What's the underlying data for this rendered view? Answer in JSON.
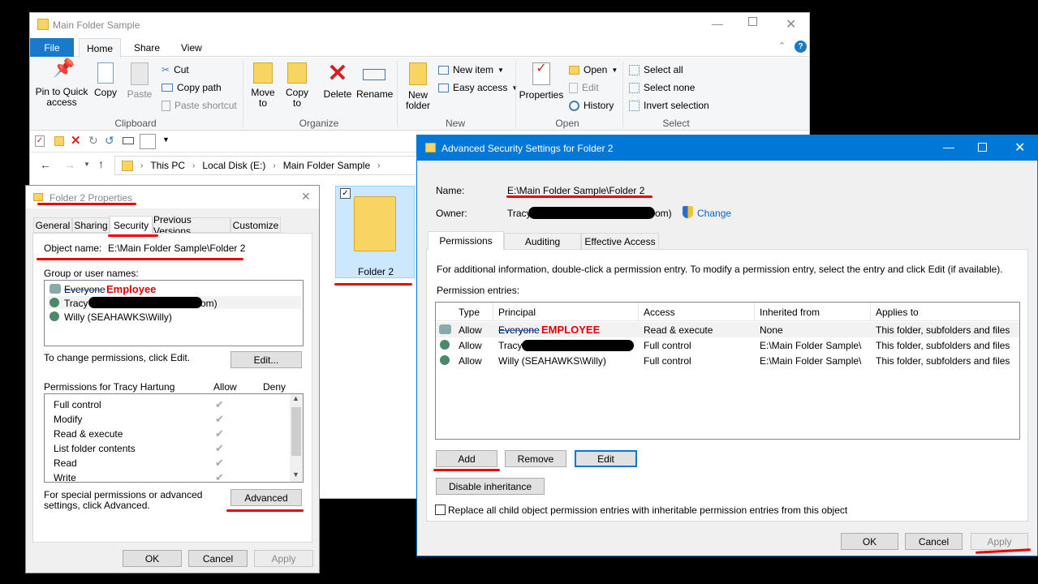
{
  "explorer": {
    "title": "Main Folder Sample",
    "tabs": [
      "File",
      "Home",
      "Share",
      "View"
    ],
    "clipboard": {
      "pin": "Pin to Quick access",
      "copy": "Copy",
      "paste": "Paste",
      "cut": "Cut",
      "copy_path": "Copy path",
      "paste_shortcut": "Paste shortcut",
      "label": "Clipboard"
    },
    "organize": {
      "move_to": "Move to",
      "copy_to": "Copy to",
      "delete": "Delete",
      "rename": "Rename",
      "label": "Organize"
    },
    "new": {
      "new_folder": "New folder",
      "new_item": "New item",
      "easy_access": "Easy access",
      "label": "New"
    },
    "open": {
      "properties": "Properties",
      "open": "Open",
      "edit": "Edit",
      "history": "History",
      "label": "Open"
    },
    "select": {
      "select_all": "Select all",
      "select_none": "Select none",
      "invert": "Invert selection",
      "label": "Select"
    },
    "breadcrumb": [
      "This PC",
      "Local Disk (E:)",
      "Main Folder Sample"
    ],
    "folder_item": "Folder 2"
  },
  "props": {
    "title": "Folder 2 Properties",
    "tabs": [
      "General",
      "Sharing",
      "Security",
      "Previous Versions",
      "Customize"
    ],
    "object_name_label": "Object name:",
    "object_name": "E:\\Main Folder Sample\\Folder 2",
    "group_label": "Group or user names:",
    "users": [
      {
        "name": "Everyone",
        "annotation": "Employee"
      },
      {
        "name_start": "Tracy",
        "name_end": "om)"
      },
      {
        "name": "Willy (SEAHAWKS\\Willy)"
      }
    ],
    "change_text": "To change permissions, click Edit.",
    "edit_button": "Edit...",
    "perm_for": "Permissions for Tracy Hartung",
    "allow_header": "Allow",
    "deny_header": "Deny",
    "permissions": [
      "Full control",
      "Modify",
      "Read & execute",
      "List folder contents",
      "Read",
      "Write"
    ],
    "special_text": "For special permissions or advanced settings, click Advanced.",
    "advanced_button": "Advanced",
    "ok": "OK",
    "cancel": "Cancel",
    "apply": "Apply"
  },
  "adv": {
    "title": "Advanced Security Settings for Folder 2",
    "name_label": "Name:",
    "name_value": "E:\\Main Folder Sample\\Folder 2",
    "owner_label": "Owner:",
    "owner_start": "Tracy",
    "owner_end": "om)",
    "change_link": "Change",
    "tabs": [
      "Permissions",
      "Auditing",
      "Effective Access"
    ],
    "info_text": "For additional information, double-click a permission entry. To modify a permission entry, select the entry and click Edit (if available).",
    "entries_label": "Permission entries:",
    "columns": [
      "Type",
      "Principal",
      "Access",
      "Inherited from",
      "Applies to"
    ],
    "rows": [
      {
        "type": "Allow",
        "principal": "Everyone",
        "annotation": "EMPLOYEE",
        "access": "Read & execute",
        "inherited": "None",
        "applies": "This folder, subfolders and files"
      },
      {
        "type": "Allow",
        "principal": "Tracy",
        "access": "Full control",
        "inherited": "E:\\Main Folder Sample\\",
        "applies": "This folder, subfolders and files"
      },
      {
        "type": "Allow",
        "principal": "Willy (SEAHAWKS\\Willy)",
        "access": "Full control",
        "inherited": "E:\\Main Folder Sample\\",
        "applies": "This folder, subfolders and files"
      }
    ],
    "add": "Add",
    "remove": "Remove",
    "edit": "Edit",
    "disable_inheritance": "Disable inheritance",
    "replace_text": "Replace all child object permission entries with inheritable permission entries from this object",
    "ok": "OK",
    "cancel": "Cancel",
    "apply": "Apply"
  },
  "colors": {
    "accent": "#0078d7",
    "annotation": "#e00000",
    "file_tab": "#1979ca"
  }
}
